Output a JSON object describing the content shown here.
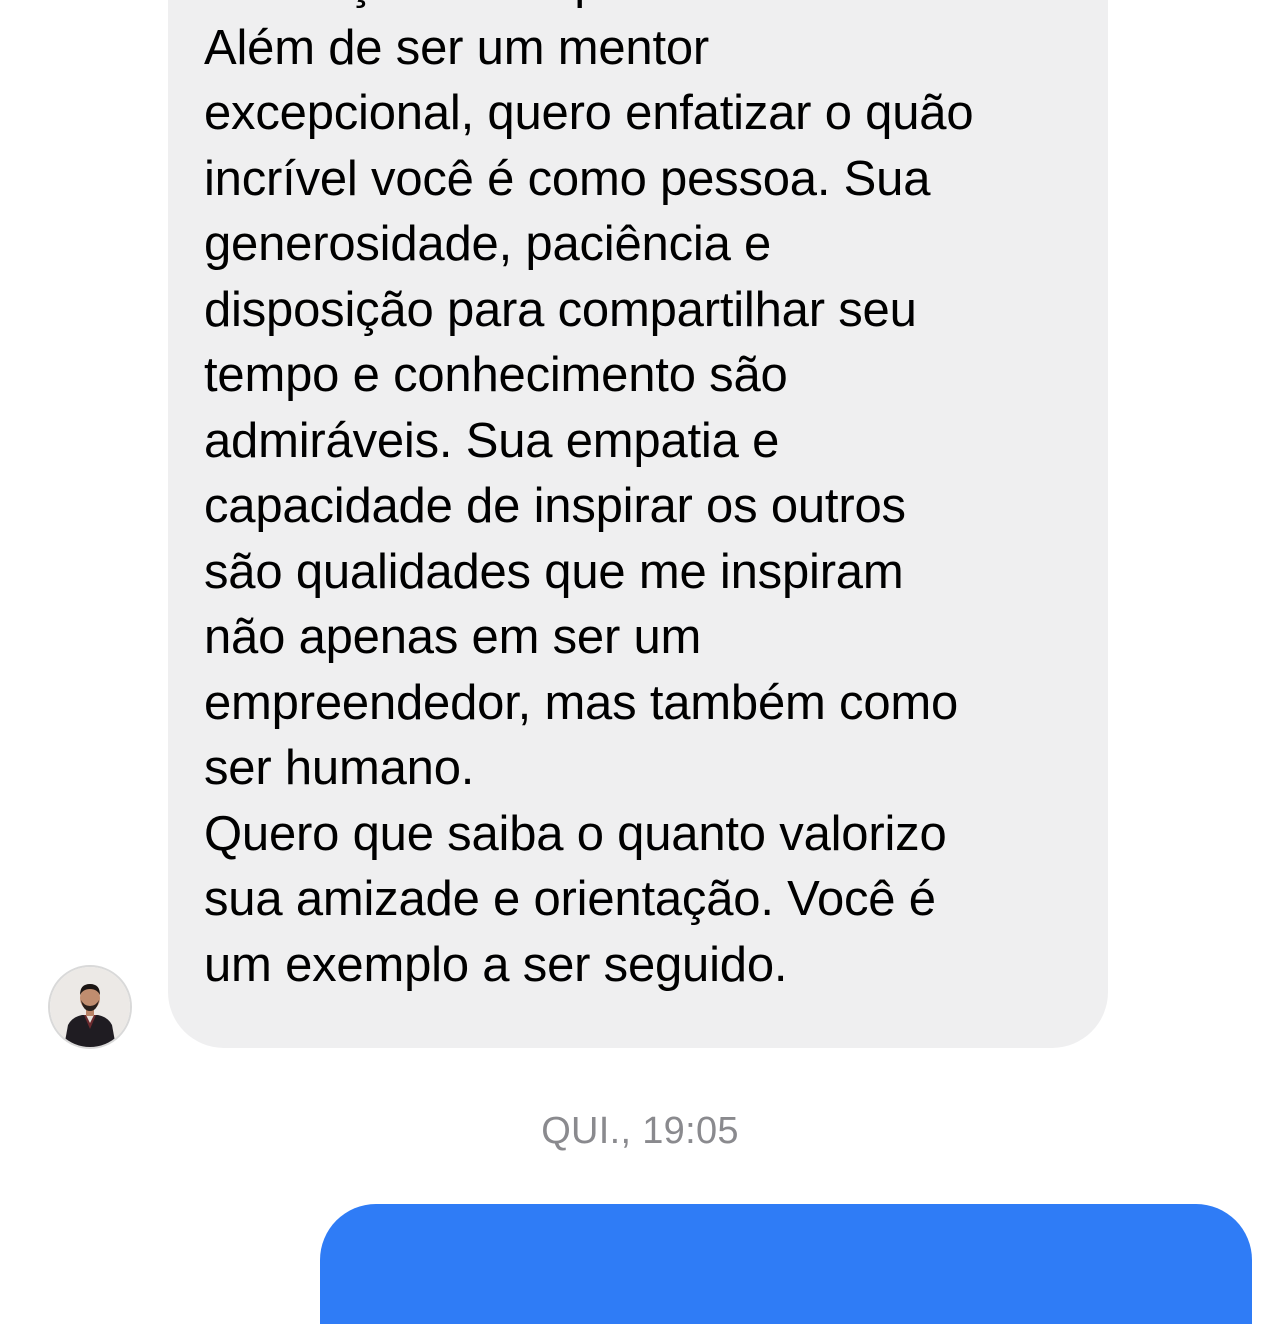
{
  "thread": {
    "incoming_message": {
      "lines": [
        "dedicação ao empreendedorismo.",
        "Além de ser um mentor",
        "excepcional, quero enfatizar o quão",
        "incrível você é como pessoa. Sua",
        "generosidade, paciência e",
        "disposição para compartilhar seu",
        "tempo e conhecimento são",
        "admiráveis. Sua empatia e",
        "capacidade de inspirar os outros",
        "são qualidades que me inspiram",
        "não apenas em ser um",
        "empreendedor, mas também como",
        "ser humano.",
        "Quero que saiba o quanto valorizo",
        "sua amizade e orientação. Você é",
        "um exemplo a ser seguido."
      ],
      "bubble_color": "#efeff0"
    },
    "sender_avatar": "person-avatar",
    "timestamp": "QUI., 19:05",
    "outgoing_message": {
      "bubble_color": "#2f7cf6"
    }
  }
}
